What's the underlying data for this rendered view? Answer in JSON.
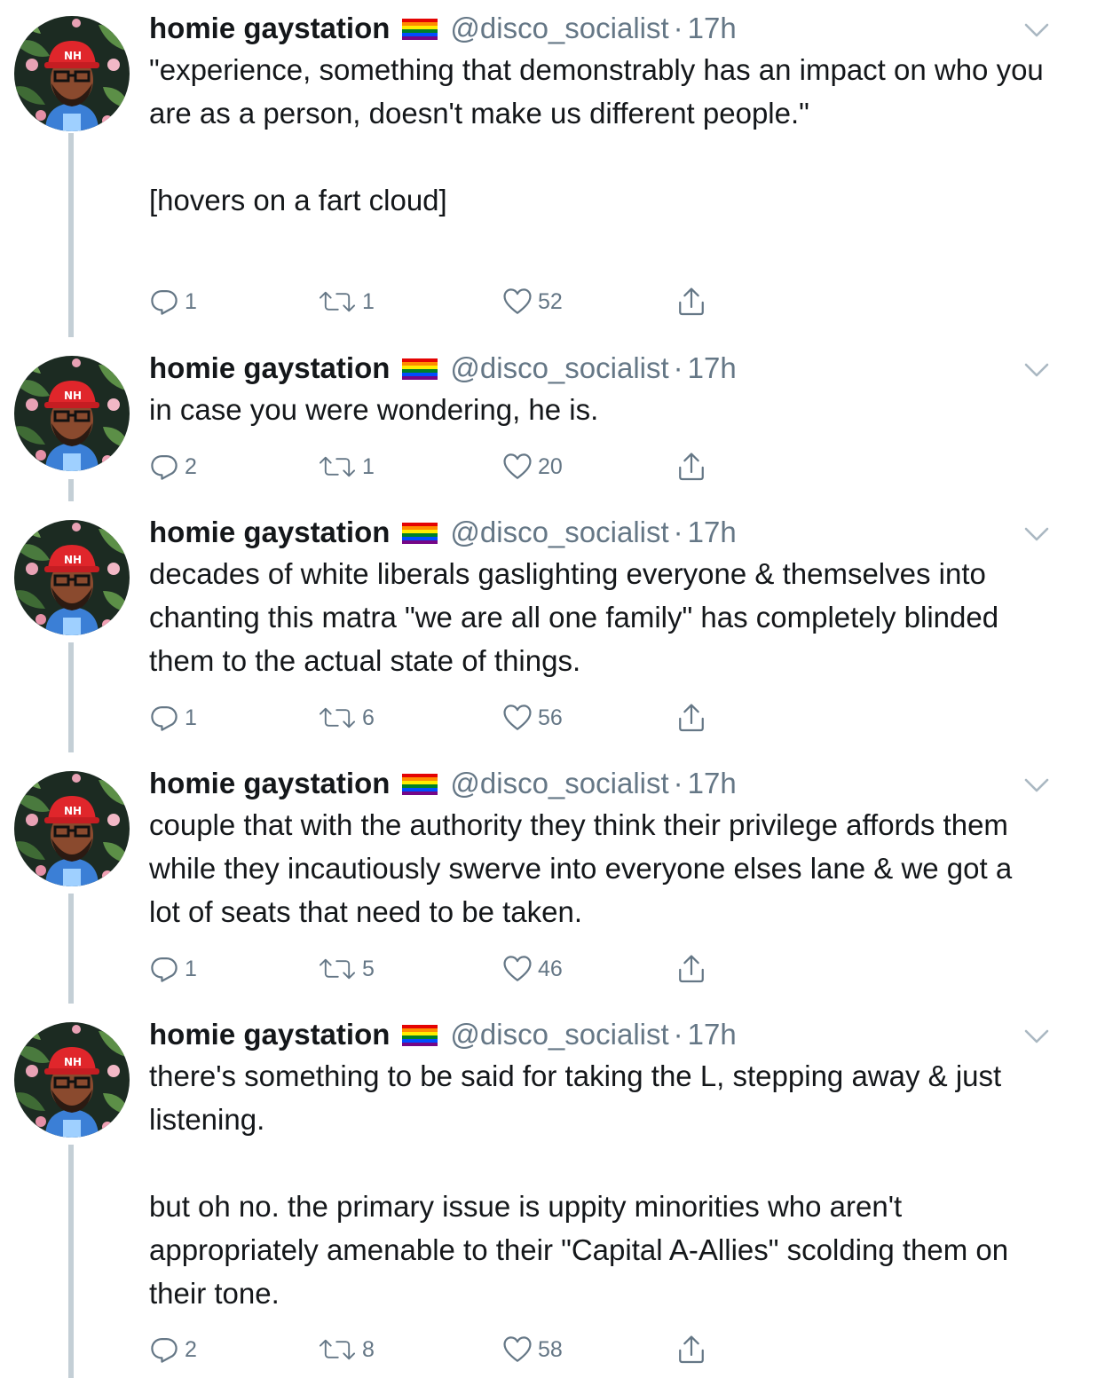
{
  "tweets": [
    {
      "display_name": "homie gaystation",
      "handle": "@disco_socialist",
      "separator": "·",
      "time": "17h",
      "text": "\"experience, something that demonstrably has an impact on who you are as a person, doesn't make us different people.\"\n\n[hovers on a fart cloud]",
      "replies": "1",
      "retweets": "1",
      "likes": "52"
    },
    {
      "display_name": "homie gaystation",
      "handle": "@disco_socialist",
      "separator": "·",
      "time": "17h",
      "text": "in case you were wondering, he is.",
      "replies": "2",
      "retweets": "1",
      "likes": "20"
    },
    {
      "display_name": "homie gaystation",
      "handle": "@disco_socialist",
      "separator": "·",
      "time": "17h",
      "text": "decades of white liberals gaslighting everyone & themselves into chanting this matra \"we are all one family\" has completely blinded them to the actual state of things.",
      "replies": "1",
      "retweets": "6",
      "likes": "56"
    },
    {
      "display_name": "homie gaystation",
      "handle": "@disco_socialist",
      "separator": "·",
      "time": "17h",
      "text": "couple that with the authority they think their privilege affords them while they incautiously swerve into everyone elses lane & we got a lot of seats that need to be taken.",
      "replies": "1",
      "retweets": "5",
      "likes": "46"
    },
    {
      "display_name": "homie gaystation",
      "handle": "@disco_socialist",
      "separator": "·",
      "time": "17h",
      "text": "there's something to be said for taking the L, stepping away & just listening.\n\nbut oh no. the primary issue is uppity minorities who aren't appropriately amenable to their \"Capital A-Allies\" scolding them on their tone.",
      "replies": "2",
      "retweets": "8",
      "likes": "58"
    }
  ],
  "icons": {
    "reply": "reply-icon",
    "retweet": "retweet-icon",
    "like": "heart-icon",
    "share": "share-icon",
    "more": "chevron-down-icon",
    "flag": "rainbow-flag-icon"
  },
  "colors": {
    "text": "#14171a",
    "secondary": "#657786",
    "thread_line": "#c4cfd6"
  }
}
